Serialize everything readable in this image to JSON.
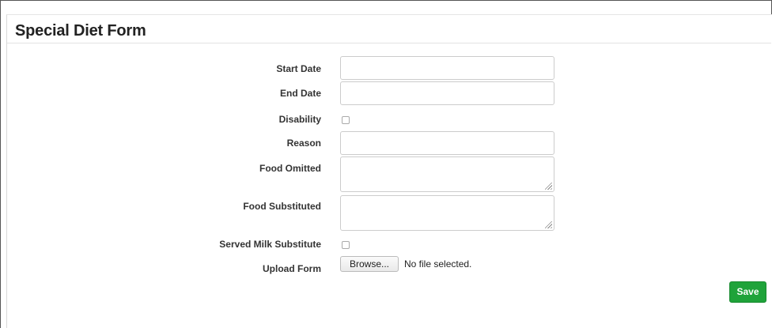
{
  "form": {
    "title": "Special Diet Form",
    "fields": {
      "start_date": {
        "label": "Start Date",
        "value": ""
      },
      "end_date": {
        "label": "End Date",
        "value": ""
      },
      "disability": {
        "label": "Disability",
        "checked": false
      },
      "reason": {
        "label": "Reason",
        "value": ""
      },
      "food_omitted": {
        "label": "Food Omitted",
        "value": ""
      },
      "food_substituted": {
        "label": "Food Substituted",
        "value": ""
      },
      "served_milk_substitute": {
        "label": "Served Milk Substitute",
        "checked": false
      },
      "upload_form": {
        "label": "Upload Form",
        "browse_label": "Browse...",
        "file_status": "No file selected."
      }
    },
    "save_label": "Save"
  },
  "colors": {
    "save_button": "#1fa33a",
    "input_border": "#cccccc",
    "title_text": "#222222"
  }
}
